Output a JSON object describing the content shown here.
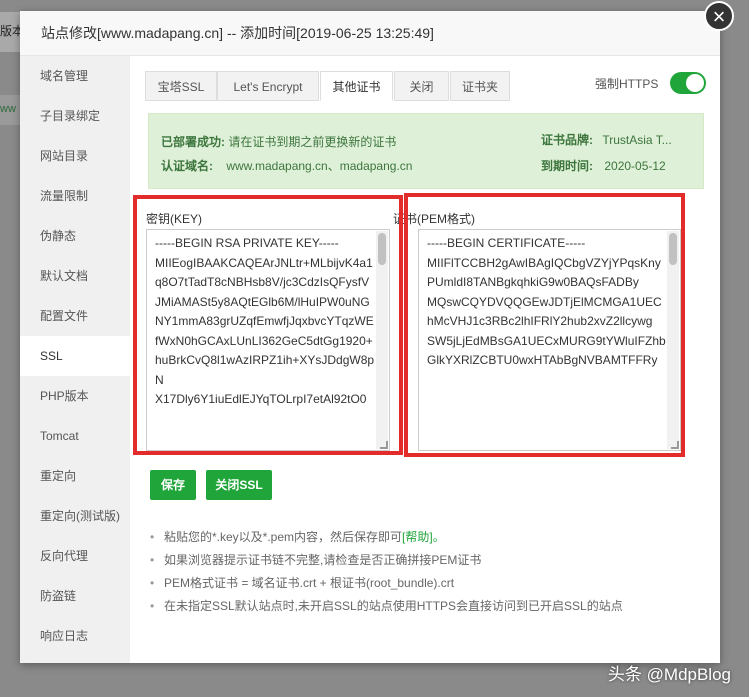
{
  "background": {
    "left_tab_text": "版本",
    "left_link_text": "ww"
  },
  "dialog": {
    "title": "站点修改[www.madapang.cn] -- 添加时间[2019-06-25 13:25:49]",
    "close_symbol": "×"
  },
  "sidebar": {
    "items": [
      {
        "label": "域名管理"
      },
      {
        "label": "子目录绑定"
      },
      {
        "label": "网站目录"
      },
      {
        "label": "流量限制"
      },
      {
        "label": "伪静态"
      },
      {
        "label": "默认文档"
      },
      {
        "label": "配置文件"
      },
      {
        "label": "SSL"
      },
      {
        "label": "PHP版本"
      },
      {
        "label": "Tomcat"
      },
      {
        "label": "重定向"
      },
      {
        "label": "重定向(测试版)"
      },
      {
        "label": "反向代理"
      },
      {
        "label": "防盗链"
      },
      {
        "label": "响应日志"
      }
    ],
    "active_index": 7
  },
  "tabs": [
    {
      "label": "宝塔SSL"
    },
    {
      "label": "Let's Encrypt"
    },
    {
      "label": "其他证书"
    },
    {
      "label": "关闭"
    },
    {
      "label": "证书夹"
    }
  ],
  "active_tab_index": 2,
  "force_https": {
    "label": "强制HTTPS",
    "enabled": true
  },
  "status": {
    "deployed_label": "已部署成功:",
    "deployed_msg": "请在证书到期之前更换新的证书",
    "brand_label": "证书品牌:",
    "brand_value": "TrustAsia T...",
    "domain_label": "认证域名:",
    "domain_value": "www.madapang.cn、madapang.cn",
    "expire_label": "到期时间:",
    "expire_value": "2020-05-12"
  },
  "key": {
    "label": "密钥(KEY)",
    "content": "-----BEGIN RSA PRIVATE KEY-----\nMIIEogIBAAKCAQEArJNLtr+MLbijvK4a1q8O7tTadT8cNBHsb8V/jc3CdzIsQFysfVJMiAMASt5y8AQtEGlb6M/lHuIPW0uNGNY1mmA83grUZqfEmwfjJqxbvcYTqzWE\nfWxN0hGCAxLUnLI362GeC5dtGg1920+huBrkCvQ8l1wAzIRPZ1ih+XYsJDdgW8pN\nX17Dly6Y1iuEdlEJYqTOLrpI7etAl92tO0"
  },
  "cert": {
    "label": "证书(PEM格式)",
    "content": "-----BEGIN CERTIFICATE-----\nMIIFlTCCBH2gAwIBAgIQCbgVZYjYPqsKnyPUmldI8TANBgkqhkiG9w0BAQsFADBy\nMQswCQYDVQQGEwJDTjElMCMGA1UEChMcVHJ1c3RBc2lhIFRlY2hub2xvZ2llcywg\nSW5jLjEdMBsGA1UECxMURG9tYWluIFZhbGlkYXRlZCBTU0wxHTAbBgNVBAMTFFRy"
  },
  "buttons": {
    "save": "保存",
    "close_ssl": "关闭SSL"
  },
  "notes": {
    "n1_prefix": "粘贴您的*.key以及*.pem内容，然后保存即可",
    "n1_help": "[帮助]。",
    "n2": "如果浏览器提示证书链不完整,请检查是否正确拼接PEM证书",
    "n3": "PEM格式证书 = 域名证书.crt + 根证书(root_bundle).crt",
    "n4": "在未指定SSL默认站点时,未开启SSL的站点使用HTTPS会直接访问到已开启SSL的站点"
  },
  "watermark": "头条 @MdpBlog",
  "colors": {
    "accent": "#20a53a",
    "highlight_box": "#e22b2b",
    "info_bg": "#dff0d8"
  }
}
